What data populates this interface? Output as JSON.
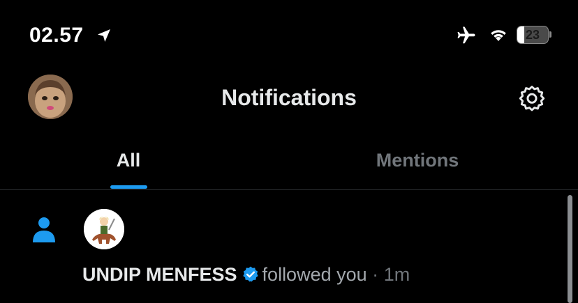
{
  "status_bar": {
    "time": "02.57",
    "battery_level": "23",
    "icons": [
      "location-arrow-icon",
      "airplane-icon",
      "wifi-icon",
      "battery-icon"
    ]
  },
  "header": {
    "title": "Notifications",
    "left": "profile-avatar",
    "right": "gear-icon"
  },
  "tabs": [
    {
      "label": "All",
      "active": true
    },
    {
      "label": "Mentions",
      "active": false
    }
  ],
  "notifications": [
    {
      "type_icon": "person-icon",
      "user_name": "UNDIP MENFESS",
      "verified": true,
      "action": "followed you",
      "separator": "·",
      "time": "1m"
    }
  ],
  "colors": {
    "accent": "#1d9bf0",
    "background": "#000000",
    "text_primary": "#e7e9ea",
    "text_secondary": "#71767b"
  }
}
